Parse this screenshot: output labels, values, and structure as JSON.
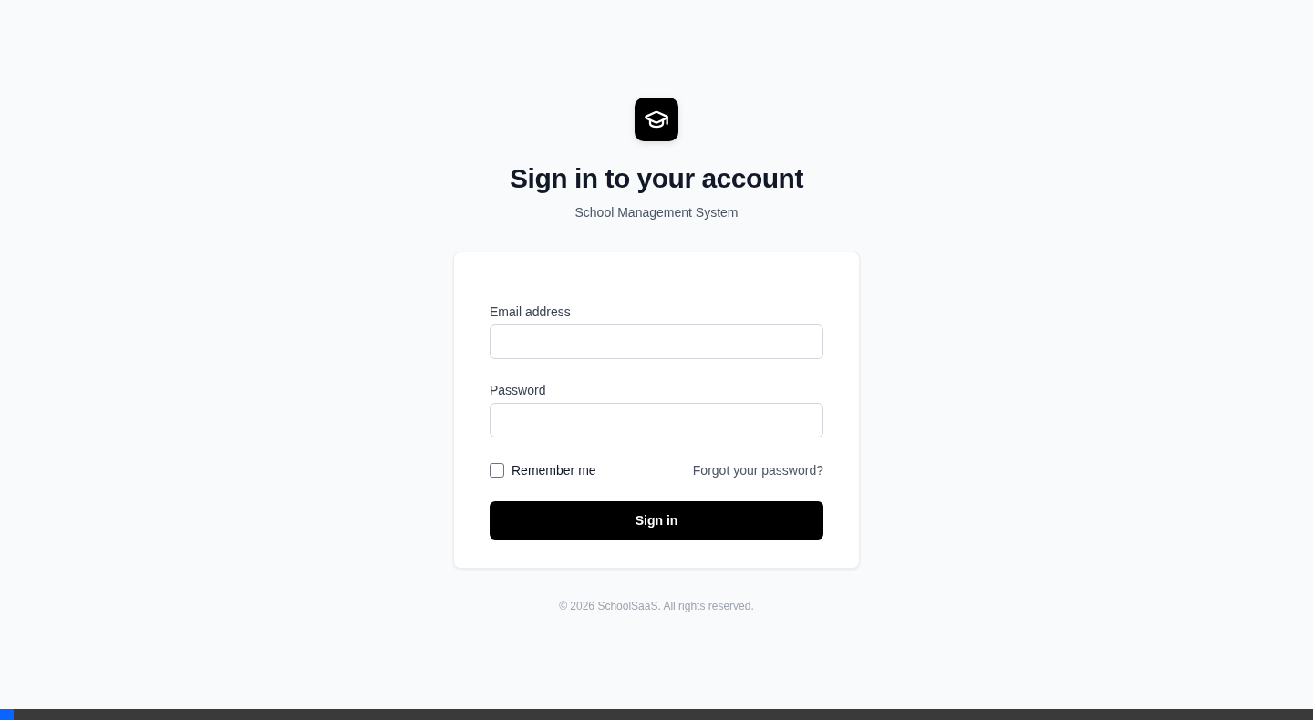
{
  "header": {
    "title": "Sign in to your account",
    "subtitle": "School Management System"
  },
  "form": {
    "fields": [
      {
        "label": "Email address"
      },
      {
        "label": "Password"
      }
    ],
    "remember": {
      "label": "Remember me",
      "checked": false
    },
    "forgot_link": "Forgot your password?",
    "submit": "Sign in"
  },
  "footer": "© 2026 SchoolSaaS. All rights reserved."
}
